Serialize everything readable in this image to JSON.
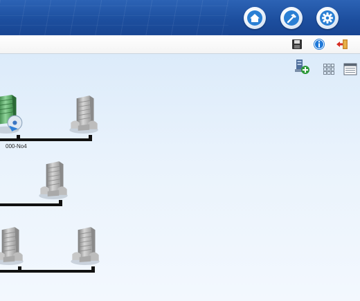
{
  "header": {
    "buttons": [
      {
        "name": "home-icon",
        "color": "#2a7fd4"
      },
      {
        "name": "hammer-icon",
        "color": "#2a7fd4"
      },
      {
        "name": "gear-icon",
        "color": "#2a7fd4"
      }
    ]
  },
  "toolbar": {
    "icons": [
      "save-icon",
      "info-icon",
      "exit-icon"
    ]
  },
  "canvas": {
    "tools": [
      "add-device-icon",
      "grid-view-icon",
      "list-view-icon"
    ],
    "nodes": [
      {
        "icon": "building-disc-icon",
        "label": "000-No4"
      },
      {
        "icon": "building-icon",
        "label": ""
      },
      {
        "icon": "building-icon",
        "label": ""
      },
      {
        "icon": "building-icon",
        "label": ""
      },
      {
        "icon": "building-icon",
        "label": ""
      }
    ]
  },
  "colors": {
    "banner": "#1d4f9f",
    "accent": "#2a7fd4",
    "bus_line": "#111111"
  }
}
